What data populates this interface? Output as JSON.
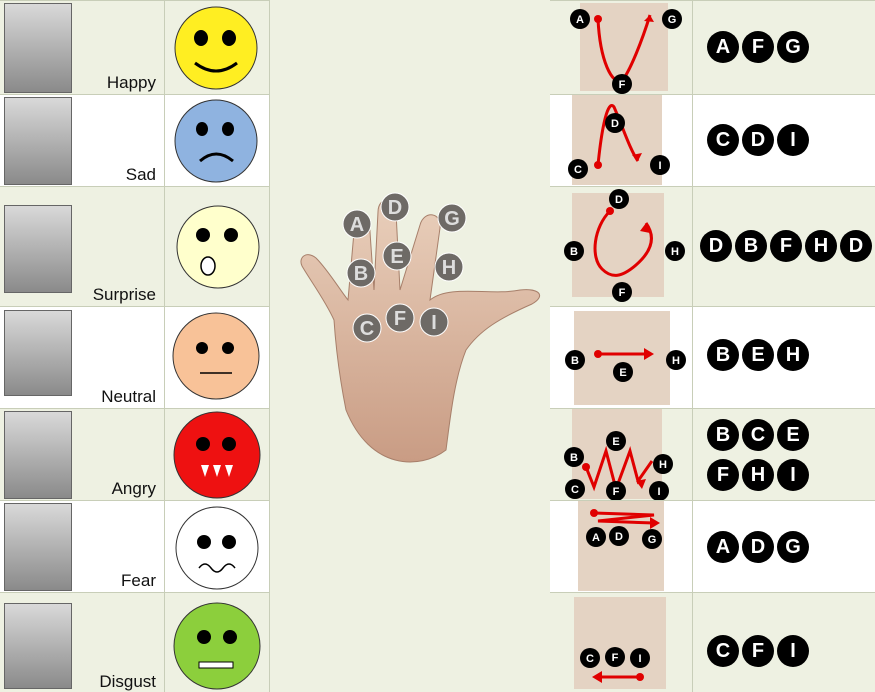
{
  "rows": [
    {
      "emotion": "Happy",
      "sequence": [
        "A",
        "F",
        "G"
      ],
      "gesture_labels": [
        "A",
        "F",
        "G"
      ]
    },
    {
      "emotion": "Sad",
      "sequence": [
        "C",
        "D",
        "I"
      ],
      "gesture_labels": [
        "C",
        "D",
        "I"
      ]
    },
    {
      "emotion": "Surprise",
      "sequence": [
        "D",
        "B",
        "F",
        "H",
        "D"
      ],
      "gesture_labels": [
        "D",
        "B",
        "F",
        "H"
      ]
    },
    {
      "emotion": "Neutral",
      "sequence": [
        "B",
        "E",
        "H"
      ],
      "gesture_labels": [
        "B",
        "E",
        "H"
      ]
    },
    {
      "emotion": "Angry",
      "sequence": [
        "B",
        "C",
        "E",
        "F",
        "H",
        "I"
      ],
      "gesture_labels": [
        "B",
        "C",
        "E",
        "F",
        "H",
        "I"
      ]
    },
    {
      "emotion": "Fear",
      "sequence": [
        "A",
        "D",
        "G"
      ],
      "gesture_labels": [
        "A",
        "D",
        "G"
      ]
    },
    {
      "emotion": "Disgust",
      "sequence": [
        "C",
        "F",
        "I"
      ],
      "gesture_labels": [
        "C",
        "F",
        "I"
      ]
    }
  ],
  "hand_points": [
    "A",
    "B",
    "C",
    "D",
    "E",
    "F",
    "G",
    "H",
    "I"
  ],
  "colors": {
    "arrow": "#e00000",
    "happy": "#ffee22",
    "sad": "#8fb3e0",
    "surprise": "#ffffcc",
    "neutral": "#f8c298",
    "angry": "#ee1111",
    "fear": "#ffffff",
    "disgust": "#8ccf3c"
  }
}
